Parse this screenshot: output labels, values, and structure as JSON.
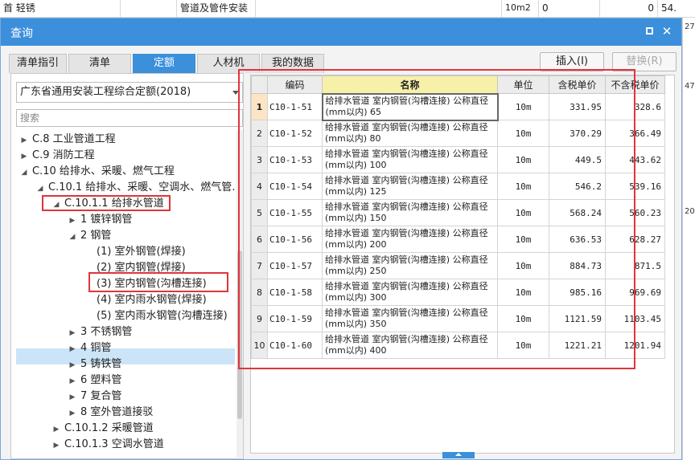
{
  "background_row": {
    "c1": "首 轻锈",
    "c2": "管道及管件安装",
    "c3": "10m2",
    "c4": "0",
    "c5": "0",
    "c6": "54.",
    "right_values": [
      "54.",
      "27.",
      "47.",
      "20."
    ]
  },
  "window": {
    "title": "查询"
  },
  "tabs": [
    {
      "label": "清单指引",
      "active": false
    },
    {
      "label": "清单",
      "active": false
    },
    {
      "label": "定额",
      "active": true
    },
    {
      "label": "人材机",
      "active": false
    },
    {
      "label": "我的数据",
      "active": false
    }
  ],
  "buttons": {
    "insert": "插入(I)",
    "replace": "替换(R)"
  },
  "library": {
    "selected": "广东省通用安装工程综合定额(2018)"
  },
  "search": {
    "placeholder": "搜索"
  },
  "tree": [
    {
      "label": "C.8 工业管道工程",
      "toggle": "▶",
      "level": 0
    },
    {
      "label": "C.9 消防工程",
      "toggle": "▶",
      "level": 0
    },
    {
      "label": "C.10 给排水、采暖、燃气工程",
      "toggle": "◢",
      "level": 0
    },
    {
      "label": "C.10.1 给排水、采暖、空调水、燃气管…",
      "toggle": "◢",
      "level": 1
    },
    {
      "label": "C.10.1.1 给排水管道",
      "toggle": "◢",
      "level": 2
    },
    {
      "label": "1 镀锌钢管",
      "toggle": "▶",
      "level": 3
    },
    {
      "label": "2 钢管",
      "toggle": "◢",
      "level": 3
    },
    {
      "label": "(1) 室外钢管(焊接)",
      "toggle": "",
      "level": 4
    },
    {
      "label": "(2) 室内钢管(焊接)",
      "toggle": "",
      "level": 4
    },
    {
      "label": "(3) 室内钢管(沟槽连接)",
      "toggle": "",
      "level": 4,
      "selected": true
    },
    {
      "label": "(4) 室内雨水钢管(焊接)",
      "toggle": "",
      "level": 4
    },
    {
      "label": "(5) 室内雨水钢管(沟槽连接)",
      "toggle": "",
      "level": 4
    },
    {
      "label": "3 不锈钢管",
      "toggle": "▶",
      "level": 3
    },
    {
      "label": "4 铜管",
      "toggle": "▶",
      "level": 3
    },
    {
      "label": "5 铸铁管",
      "toggle": "▶",
      "level": 3
    },
    {
      "label": "6 塑料管",
      "toggle": "▶",
      "level": 3
    },
    {
      "label": "7 复合管",
      "toggle": "▶",
      "level": 3
    },
    {
      "label": "8 室外管道接驳",
      "toggle": "▶",
      "level": 3
    },
    {
      "label": "C.10.1.2 采暖管道",
      "toggle": "▶",
      "level": 2
    },
    {
      "label": "C.10.1.3 空调水管道",
      "toggle": "▶",
      "level": 2
    }
  ],
  "grid": {
    "columns": [
      "",
      "编码",
      "名称",
      "单位",
      "含税单价",
      "不含税单价"
    ],
    "rows": [
      {
        "idx": "1",
        "code": "C10-1-51",
        "name": "给排水管道 室内钢管(沟槽连接) 公称直径(mm以内) 65",
        "unit": "10m",
        "tax_price": "331.95",
        "notax_price": "328.6"
      },
      {
        "idx": "2",
        "code": "C10-1-52",
        "name": "给排水管道 室内钢管(沟槽连接) 公称直径(mm以内) 80",
        "unit": "10m",
        "tax_price": "370.29",
        "notax_price": "366.49"
      },
      {
        "idx": "3",
        "code": "C10-1-53",
        "name": "给排水管道 室内钢管(沟槽连接) 公称直径(mm以内) 100",
        "unit": "10m",
        "tax_price": "449.5",
        "notax_price": "443.62"
      },
      {
        "idx": "4",
        "code": "C10-1-54",
        "name": "给排水管道 室内钢管(沟槽连接) 公称直径(mm以内) 125",
        "unit": "10m",
        "tax_price": "546.2",
        "notax_price": "539.16"
      },
      {
        "idx": "5",
        "code": "C10-1-55",
        "name": "给排水管道 室内钢管(沟槽连接) 公称直径(mm以内) 150",
        "unit": "10m",
        "tax_price": "568.24",
        "notax_price": "560.23"
      },
      {
        "idx": "6",
        "code": "C10-1-56",
        "name": "给排水管道 室内钢管(沟槽连接) 公称直径(mm以内) 200",
        "unit": "10m",
        "tax_price": "636.53",
        "notax_price": "628.27"
      },
      {
        "idx": "7",
        "code": "C10-1-57",
        "name": "给排水管道 室内钢管(沟槽连接) 公称直径(mm以内) 250",
        "unit": "10m",
        "tax_price": "884.73",
        "notax_price": "871.5"
      },
      {
        "idx": "8",
        "code": "C10-1-58",
        "name": "给排水管道 室内钢管(沟槽连接) 公称直径(mm以内) 300",
        "unit": "10m",
        "tax_price": "985.16",
        "notax_price": "969.69"
      },
      {
        "idx": "9",
        "code": "C10-1-59",
        "name": "给排水管道 室内钢管(沟槽连接) 公称直径(mm以内) 350",
        "unit": "10m",
        "tax_price": "1121.59",
        "notax_price": "1103.45"
      },
      {
        "idx": "10",
        "code": "C10-1-60",
        "name": "给排水管道 室内钢管(沟槽连接) 公称直径(mm以内) 400",
        "unit": "10m",
        "tax_price": "1221.21",
        "notax_price": "1201.94"
      }
    ]
  },
  "colors": {
    "accent": "#3b8fdb",
    "highlight": "#e0343c",
    "selection": "#cce4f7",
    "name_header": "#f6f0a8"
  }
}
